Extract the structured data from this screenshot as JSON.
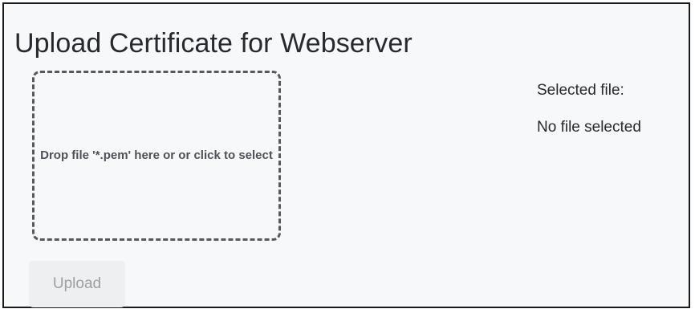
{
  "page": {
    "title": "Upload Certificate for Webserver"
  },
  "dropzone": {
    "instruction": "Drop file '*.pem' here or or click to select"
  },
  "selection": {
    "label": "Selected file:",
    "value": "No file selected"
  },
  "actions": {
    "upload_label": "Upload",
    "upload_enabled": false
  },
  "colors": {
    "background": "#f7f8fa",
    "text": "#262a2e",
    "dropzone_border": "#555a60",
    "disabled_button_bg": "#eeeff1",
    "disabled_button_text": "#9aa0a6"
  }
}
